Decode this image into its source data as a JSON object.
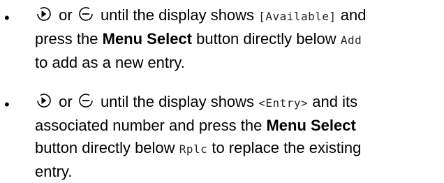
{
  "items": [
    {
      "bullet": "•",
      "or": "or",
      "until": "until the display shows",
      "display_text": "[Available]",
      "and": "and",
      "press_the": "press the",
      "button_name": "Menu Select",
      "button_directly_below": "button directly below",
      "softkey": "Add",
      "tail": "to add as a new entry."
    },
    {
      "bullet": "•",
      "or": "or",
      "until": "until the display shows",
      "display_text": "<Entry>",
      "and_its": "and its",
      "associated": "associated number and press the",
      "button_name": "Menu Select",
      "button_directly_below": "button directly below",
      "softkey": "Rplc",
      "to_replace": "to replace the existing",
      "tail": "entry."
    }
  ],
  "icons": {
    "right": "right-arrow-button-icon",
    "left": "left-arrow-button-icon"
  }
}
